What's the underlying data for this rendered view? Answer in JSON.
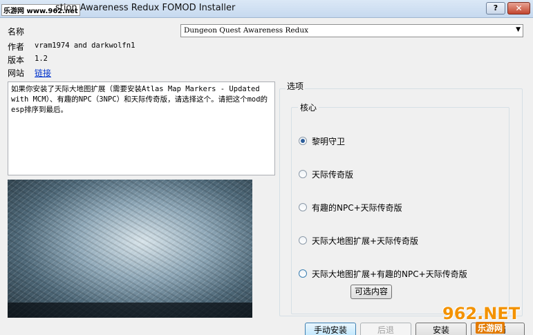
{
  "window": {
    "title": "stion Awareness Redux FOMOD Installer",
    "watermark_top": "乐游网 www.962.net",
    "help_label": "?",
    "close_label": "✕"
  },
  "info": {
    "name_label": "名称",
    "name_value": "Dungeon Quest Awareness Redux",
    "author_label": "作者",
    "author_value": "vram1974 and darkwolfn1",
    "version_label": "版本",
    "version_value": "1.2",
    "website_label": "网站",
    "website_link": "链接"
  },
  "description": "如果你安装了天际大地图扩展（需要安装Atlas Map Markers - Updated with MCM）、有趣的NPC（3NPC）和天际传奇版，请选择这个。请把这个mod的esp排序到最后。",
  "options": {
    "group_label": "选项",
    "core_label": "核心",
    "items": [
      {
        "label": "黎明守卫",
        "checked": true
      },
      {
        "label": "天际传奇版",
        "checked": false
      },
      {
        "label": "有趣的NPC+天际传奇版",
        "checked": false
      },
      {
        "label": "天际大地图扩展+天际传奇版",
        "checked": false
      },
      {
        "label": "天际大地图扩展+有趣的NPC+天际传奇版",
        "checked": false
      }
    ],
    "optional_content_button": "可选内容"
  },
  "buttons": {
    "manual_install": "手动安装",
    "back": "后退",
    "install": "安装",
    "cancel": "取消"
  },
  "watermark_br": {
    "big": "962.NET",
    "small": "乐游网"
  },
  "icons": [
    "help-icon",
    "close-icon",
    "chevron-down-icon"
  ]
}
